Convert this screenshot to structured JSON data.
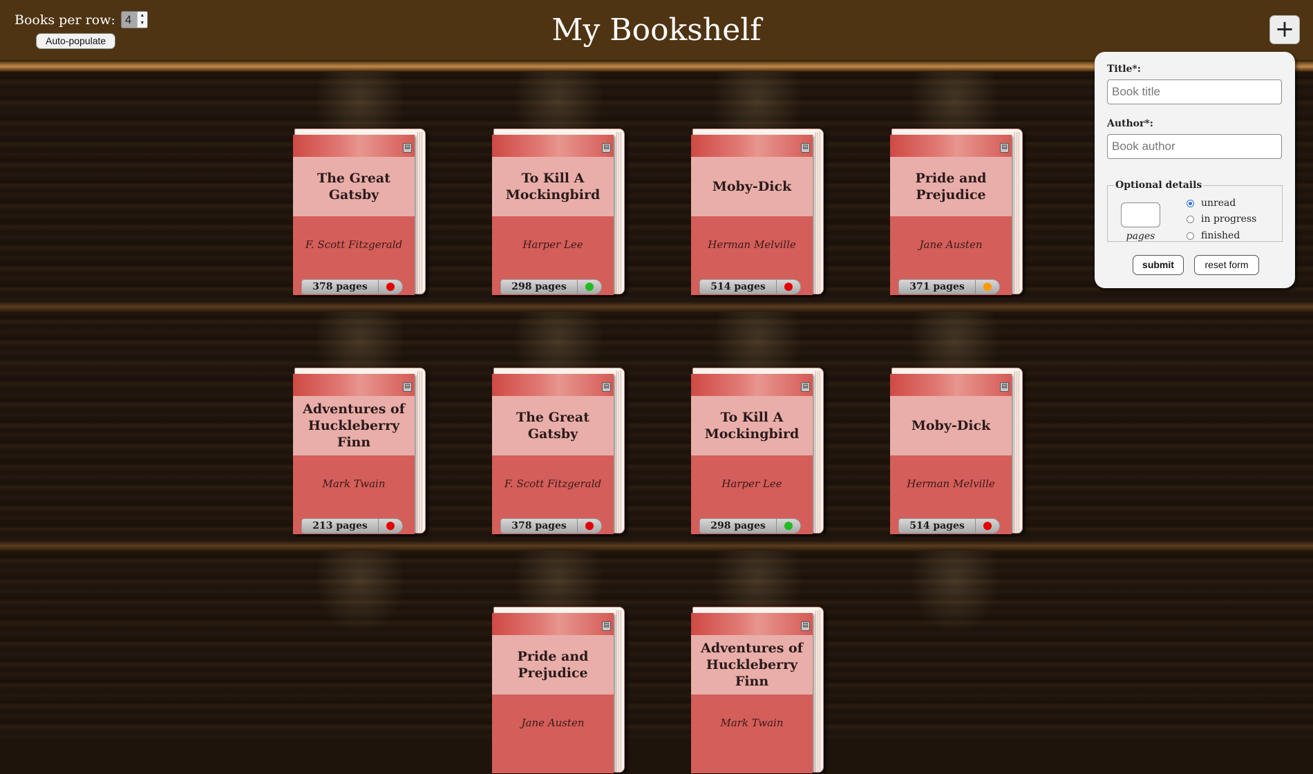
{
  "header": {
    "title": "My Bookshelf",
    "per_row_label": "Books per row:",
    "per_row_value": "4",
    "auto_populate_label": "Auto-populate",
    "add_icon": "plus-icon"
  },
  "colors": {
    "header_bg": "#4f3413",
    "cover": "#d45e59",
    "title_area": "#e9aea9",
    "status_unread": "#e00000",
    "status_in_progress": "#ff9900",
    "status_finished": "#22bb22"
  },
  "books": [
    {
      "title": "The Great Gatsby",
      "author": "F. Scott Fitzgerald",
      "pages": "378 pages",
      "status": "unread"
    },
    {
      "title": "To Kill A Mockingbird",
      "author": "Harper Lee",
      "pages": "298 pages",
      "status": "finished"
    },
    {
      "title": "Moby-Dick",
      "author": "Herman Melville",
      "pages": "514 pages",
      "status": "unread"
    },
    {
      "title": "Pride and Prejudice",
      "author": "Jane Austen",
      "pages": "371 pages",
      "status": "in progress"
    },
    {
      "title": "Adventures of Huckleberry Finn",
      "author": "Mark Twain",
      "pages": "213 pages",
      "status": "unread"
    },
    {
      "title": "The Great Gatsby",
      "author": "F. Scott Fitzgerald",
      "pages": "378 pages",
      "status": "unread"
    },
    {
      "title": "To Kill A Mockingbird",
      "author": "Harper Lee",
      "pages": "298 pages",
      "status": "finished"
    },
    {
      "title": "Moby-Dick",
      "author": "Herman Melville",
      "pages": "514 pages",
      "status": "unread"
    },
    {
      "title": "Pride and Prejudice",
      "author": "Jane Austen",
      "pages": "",
      "status": ""
    },
    {
      "title": "Adventures of Huckleberry Finn",
      "author": "Mark Twain",
      "pages": "",
      "status": ""
    }
  ],
  "form": {
    "title_label": "Title*:",
    "title_placeholder": "Book title",
    "author_label": "Author*:",
    "author_placeholder": "Book author",
    "optional_legend": "Optional details",
    "pages_caption": "pages",
    "status_options": [
      "unread",
      "in progress",
      "finished"
    ],
    "selected_status": "unread",
    "submit_label": "submit",
    "reset_label": "reset form"
  }
}
